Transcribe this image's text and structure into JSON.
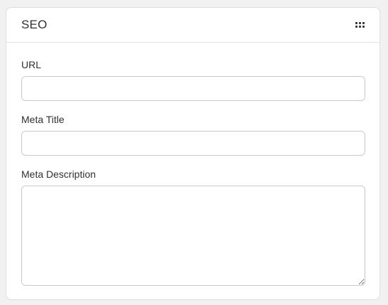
{
  "card": {
    "title": "SEO",
    "handle_icon": "drag-handle-icon"
  },
  "fields": {
    "url": {
      "label": "URL",
      "value": ""
    },
    "meta_title": {
      "label": "Meta Title",
      "value": ""
    },
    "meta_description": {
      "label": "Meta Description",
      "value": ""
    }
  }
}
